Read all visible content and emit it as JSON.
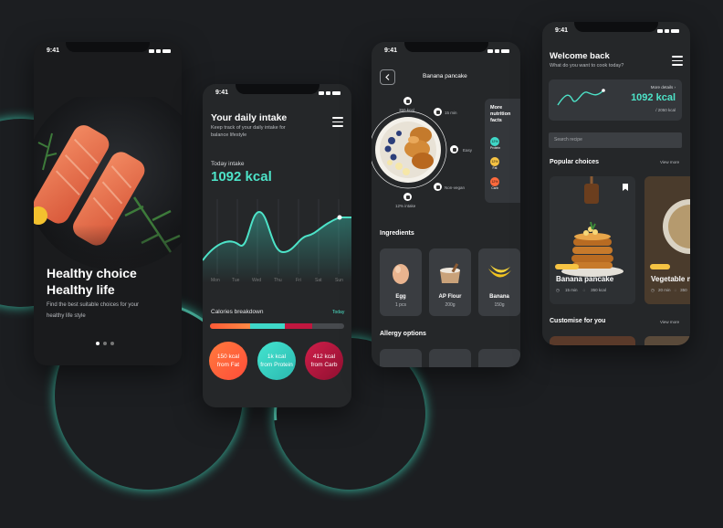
{
  "colors": {
    "accent": "#4de3c8",
    "fat": "#ff6a3d",
    "protein": "#3fd8c8",
    "carb": "#c0173f",
    "bg": "#1c1e21"
  },
  "status_time": "9:41",
  "screen1": {
    "title_line1": "Healthy choice",
    "title_line2": "Healthy life",
    "subtitle_line1": "Find the best suitable choices for your",
    "subtitle_line2": "healthy life style",
    "pager_active": 1,
    "pager_total": 3
  },
  "screen2": {
    "title": "Your daily intake",
    "subtitle_line1": "Keep track of your daily intake for",
    "subtitle_line2": "balance lifestyle",
    "intake_label": "Today intake",
    "intake_value": "1092 kcal",
    "days": [
      "Mon",
      "Tue",
      "Wed",
      "Thu",
      "Fri",
      "Sat",
      "Sun"
    ],
    "breakdown_label": "Calories breakdown",
    "breakdown_period": "Today",
    "bar_shares": {
      "fat": 0.3,
      "protein": 0.26,
      "carb": 0.2
    },
    "fat_value": "150 kcal",
    "fat_label": "from Fat",
    "protein_value": "1k kcal",
    "protein_label": "from Protein",
    "carb_value": "412 kcal",
    "carb_label": "from Carb"
  },
  "screen3": {
    "title": "Banana pancake",
    "back_icon": "chevron-left-icon",
    "stats": {
      "kcal": "350 kcal",
      "time": "15 min",
      "difficulty": "Easy",
      "diet": "Non-vegan",
      "intake": "12% intake"
    },
    "nutrition_title_line1": "More",
    "nutrition_title_line2": "nutrition",
    "nutrition_title_line3": "facts",
    "nutrition": [
      {
        "val": "12%",
        "name": "Protein",
        "color": "#3fd8c8"
      },
      {
        "val": "12%",
        "name": "Fat",
        "color": "#f6c343"
      },
      {
        "val": "12%",
        "name": "Carb",
        "color": "#ff6a3d"
      }
    ],
    "ingredients_label": "Ingredients",
    "ingredients": [
      {
        "name": "Egg",
        "qty": "1 pcs"
      },
      {
        "name": "AP Flour",
        "qty": "200g"
      },
      {
        "name": "Banana",
        "qty": "150g"
      }
    ],
    "allergy_label": "Allergy options"
  },
  "screen4": {
    "title": "Welcome back",
    "subtitle": "What do you want to cook today?",
    "more_details": "More details",
    "kcal": "1092 kcal",
    "goal": "/ 2050 kcal",
    "search_placeholder": "Search recipe",
    "popular_label": "Popular choices",
    "view_more": "View more",
    "cards": [
      {
        "name": "Banana pancake",
        "time": "15 min",
        "kcal": "350 kcal"
      },
      {
        "name": "Vegetable n",
        "time": "20 min",
        "kcal": "350"
      }
    ],
    "customise_label": "Customise for you",
    "view_more_2": "View more"
  }
}
